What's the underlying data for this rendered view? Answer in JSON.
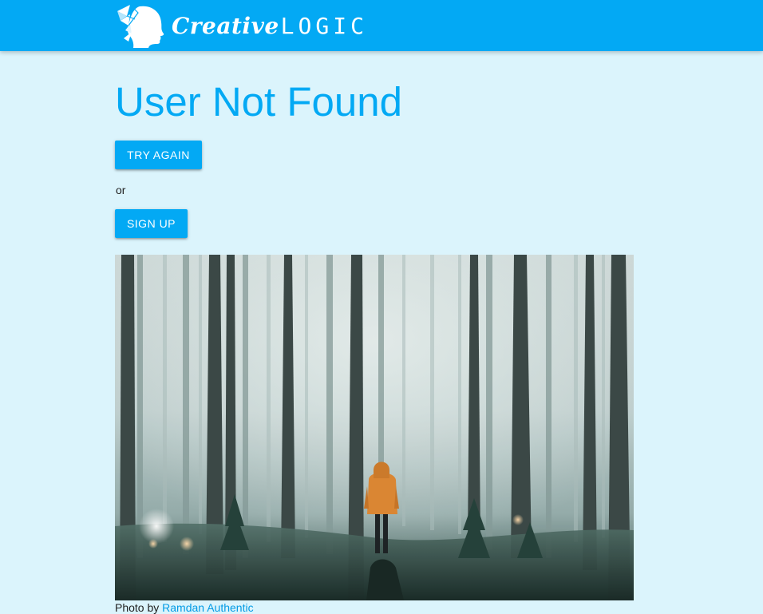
{
  "header": {
    "logo": {
      "icon": "origami-head-logo-icon",
      "brand_part_1": "Creative",
      "brand_part_2": "LOGIC"
    },
    "background_color": "#03a9f4"
  },
  "main": {
    "title": "User Not Found",
    "try_again_label": "TRY AGAIN",
    "or_text": "or",
    "sign_up_label": "SIGN UP",
    "photo": {
      "subject": "person in orange hooded jacket standing in a foggy forest",
      "caption_prefix": "Photo by",
      "author_name": "Ramdan Authentic"
    }
  },
  "colors": {
    "accent": "#03a9f4",
    "page_background": "#dbf4fc",
    "link": "#039be5"
  }
}
